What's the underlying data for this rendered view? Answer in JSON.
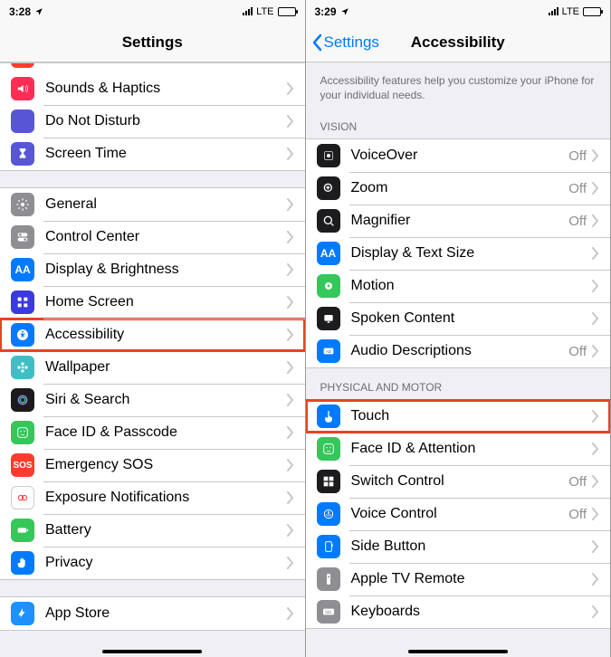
{
  "left": {
    "time": "3:28",
    "signal_text": "LTE",
    "title": "Settings",
    "groups": [
      {
        "items": [
          {
            "id": "notifications-clip",
            "icon": "notifications",
            "color": "#ff3b30",
            "label": "",
            "clipped": true
          },
          {
            "id": "sounds",
            "icon": "sound",
            "color": "#ff2d55",
            "label": "Sounds & Haptics"
          },
          {
            "id": "dnd",
            "icon": "moon",
            "color": "#5856d6",
            "label": "Do Not Disturb"
          },
          {
            "id": "screentime",
            "icon": "hourglass",
            "color": "#5856d6",
            "label": "Screen Time"
          }
        ]
      },
      {
        "items": [
          {
            "id": "general",
            "icon": "gear",
            "color": "#8e8e93",
            "label": "General"
          },
          {
            "id": "control-center",
            "icon": "switch",
            "color": "#8e8e93",
            "label": "Control Center"
          },
          {
            "id": "display",
            "icon": "aa",
            "color": "#007aff",
            "label": "Display & Brightness"
          },
          {
            "id": "home-screen",
            "icon": "grid",
            "color": "#3a3adf",
            "label": "Home Screen"
          },
          {
            "id": "accessibility",
            "icon": "access",
            "color": "#007aff",
            "label": "Accessibility",
            "highlight": true
          },
          {
            "id": "wallpaper",
            "icon": "flower",
            "color": "#3fbfc5",
            "label": "Wallpaper"
          },
          {
            "id": "siri",
            "icon": "siri",
            "color": "#1b1b1d",
            "label": "Siri & Search"
          },
          {
            "id": "faceid",
            "icon": "face",
            "color": "#34c759",
            "label": "Face ID & Passcode"
          },
          {
            "id": "sos",
            "icon": "sos",
            "color": "#ff3b30",
            "label": "Emergency SOS"
          },
          {
            "id": "exposure",
            "icon": "exposure",
            "color": "#ffffff",
            "label": "Exposure Notifications",
            "border": true
          },
          {
            "id": "battery",
            "icon": "battery",
            "color": "#34c759",
            "label": "Battery"
          },
          {
            "id": "privacy",
            "icon": "hand",
            "color": "#007aff",
            "label": "Privacy"
          }
        ]
      },
      {
        "items": [
          {
            "id": "app-store",
            "icon": "appstore",
            "color": "#1e90ff",
            "label": "App Store"
          }
        ]
      }
    ]
  },
  "right": {
    "time": "3:29",
    "signal_text": "LTE",
    "back": "Settings",
    "title": "Accessibility",
    "description": "Accessibility features help you customize your iPhone for your individual needs.",
    "sections": [
      {
        "header": "VISION",
        "items": [
          {
            "id": "voiceover",
            "icon": "voiceover",
            "color": "#1c1c1e",
            "label": "VoiceOver",
            "detail": "Off"
          },
          {
            "id": "zoom",
            "icon": "zoom",
            "color": "#1c1c1e",
            "label": "Zoom",
            "detail": "Off"
          },
          {
            "id": "magnifier",
            "icon": "magnifier",
            "color": "#1c1c1e",
            "label": "Magnifier",
            "detail": "Off"
          },
          {
            "id": "text-size",
            "icon": "aa",
            "color": "#007aff",
            "label": "Display & Text Size"
          },
          {
            "id": "motion",
            "icon": "motion",
            "color": "#34c759",
            "label": "Motion"
          },
          {
            "id": "spoken",
            "icon": "spoken",
            "color": "#1c1c1e",
            "label": "Spoken Content"
          },
          {
            "id": "audio-desc",
            "icon": "audiodesc",
            "color": "#007aff",
            "label": "Audio Descriptions",
            "detail": "Off"
          }
        ]
      },
      {
        "header": "PHYSICAL AND MOTOR",
        "items": [
          {
            "id": "touch",
            "icon": "touch",
            "color": "#007aff",
            "label": "Touch",
            "highlight": true
          },
          {
            "id": "face-attn",
            "icon": "face",
            "color": "#34c759",
            "label": "Face ID & Attention"
          },
          {
            "id": "switch-ctrl",
            "icon": "switchctrl",
            "color": "#1c1c1e",
            "label": "Switch Control",
            "detail": "Off"
          },
          {
            "id": "voice-ctrl",
            "icon": "voicectrl",
            "color": "#007aff",
            "label": "Voice Control",
            "detail": "Off"
          },
          {
            "id": "side-button",
            "icon": "sidebutton",
            "color": "#007aff",
            "label": "Side Button"
          },
          {
            "id": "tv-remote",
            "icon": "tvremote",
            "color": "#8e8e93",
            "label": "Apple TV Remote"
          },
          {
            "id": "keyboards",
            "icon": "keyboard",
            "color": "#8e8e93",
            "label": "Keyboards"
          }
        ]
      }
    ]
  }
}
